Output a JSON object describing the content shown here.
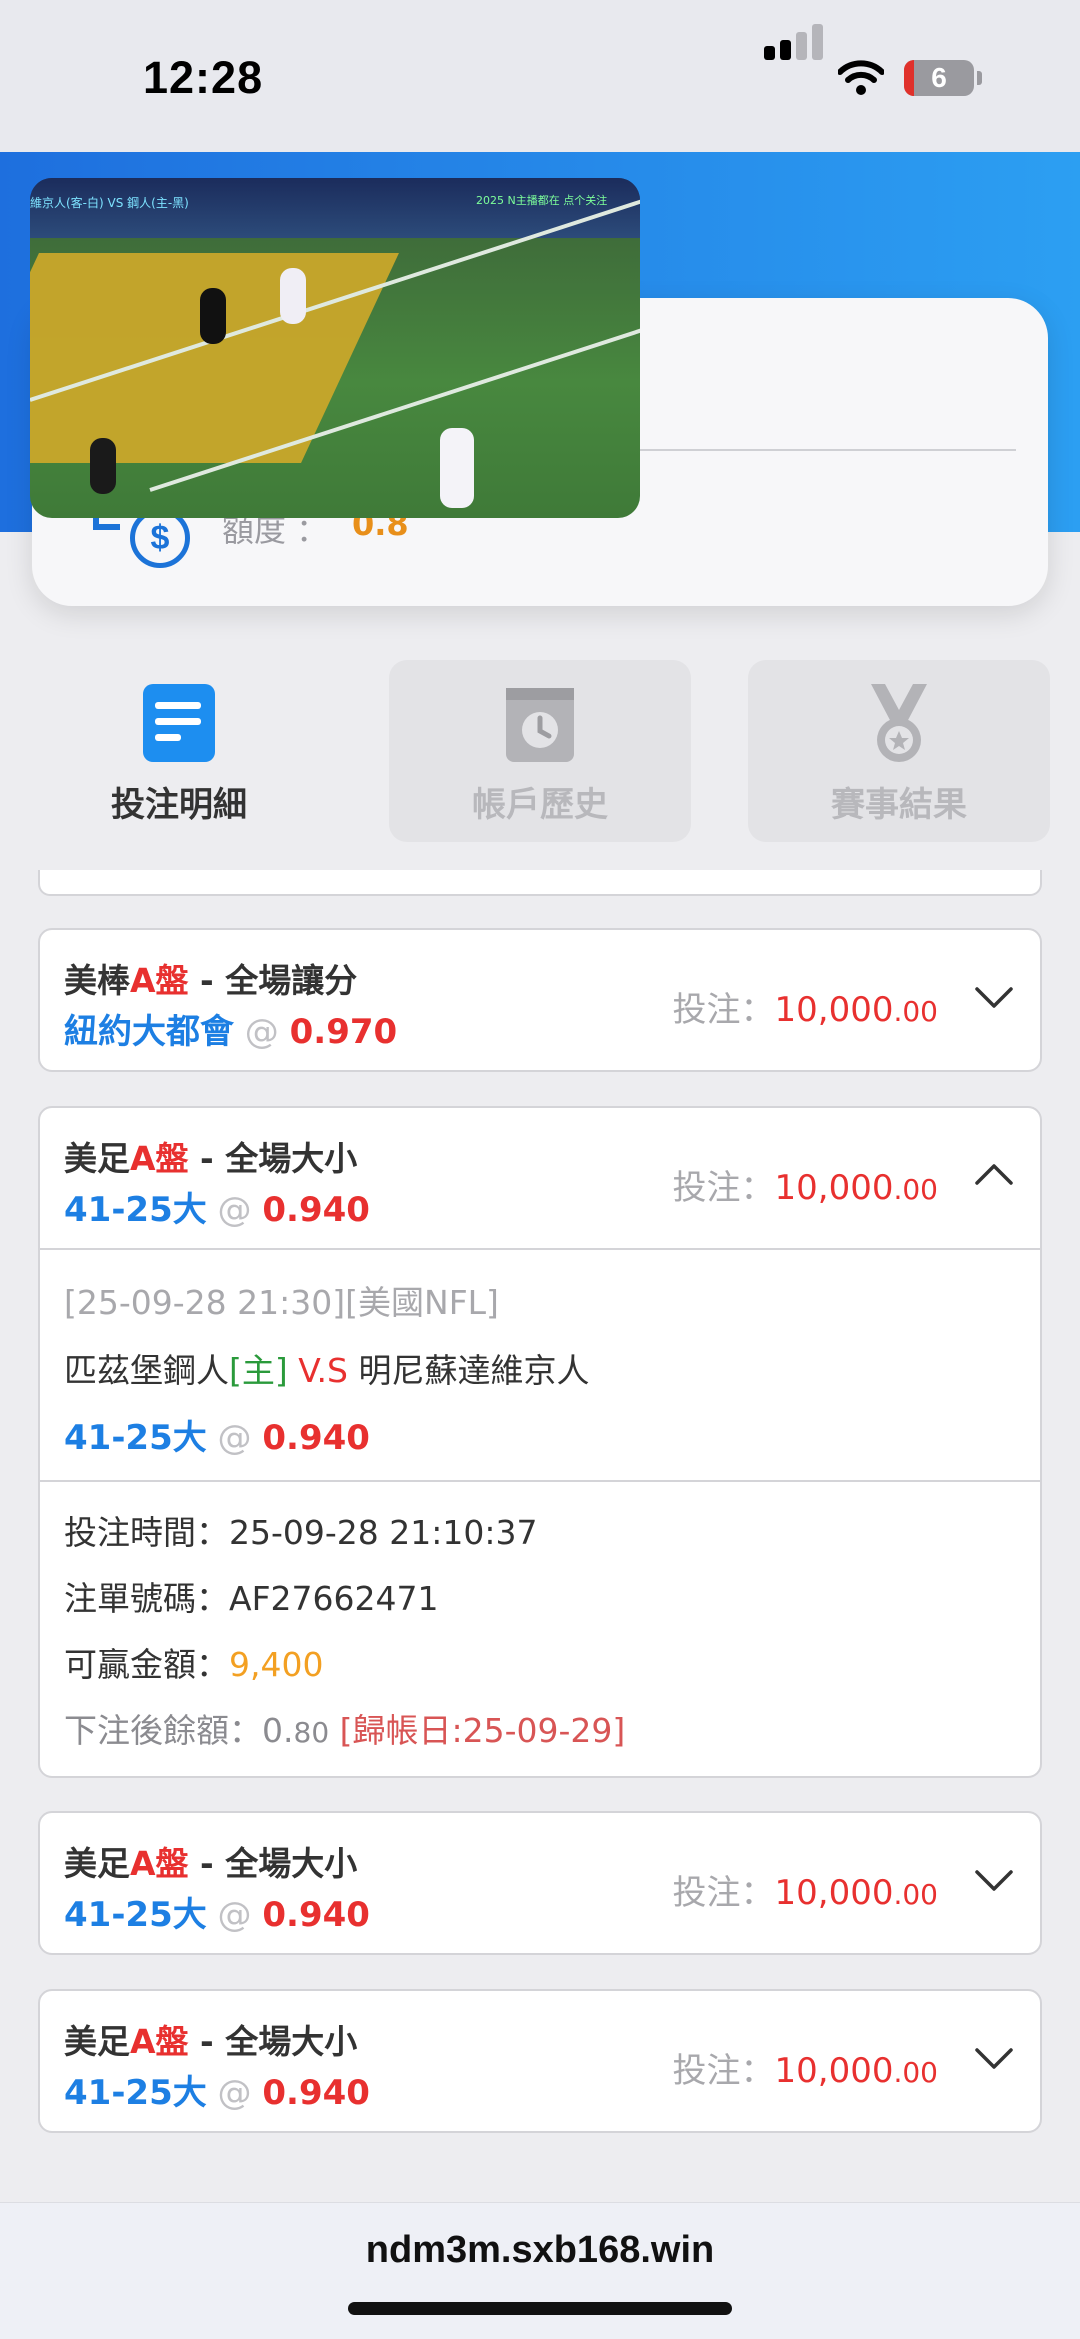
{
  "status_bar": {
    "time": "12:28",
    "battery": "6"
  },
  "account": {
    "partial_text": "4",
    "credit_label": "額度 ：",
    "credit_value": "0.8"
  },
  "tabs": [
    {
      "label": "投注明細",
      "icon": "receipt-icon",
      "active": true
    },
    {
      "label": "帳戶歷史",
      "icon": "clock-calendar-icon",
      "active": false
    },
    {
      "label": "賽事結果",
      "icon": "medal-icon",
      "active": false
    }
  ],
  "bets": [
    {
      "sport": "美棒",
      "market_code": "A盤",
      "market": " - 全場讓分",
      "pick": "紐約大都會",
      "at": " @ ",
      "odds": "0.970",
      "stake_label": "投注：",
      "stake_int": "10,000",
      "stake_dec": ".00",
      "expanded": false
    },
    {
      "sport": "美足",
      "market_code": "A盤",
      "market": " - 全場大小",
      "pick": "41-25大",
      "at": " @ ",
      "odds": "0.940",
      "stake_label": "投注：",
      "stake_int": "10,000",
      "stake_dec": ".00",
      "expanded": true,
      "detail": {
        "match_time": "[25-09-28 21:30][美國NFL]",
        "home_team": "匹茲堡鋼人",
        "home_tag": "[主]",
        "vs": " V.S ",
        "away_team": "明尼蘇達維京人",
        "pick": "41-25大",
        "odds": "0.940",
        "bet_time_label": "投注時間：",
        "bet_time": "25-09-28 21:10:37",
        "ticket_label": "注單號碼：",
        "ticket": "AF27662471",
        "win_label": "可贏金額：",
        "win": "9,400",
        "balance_label": "下注後餘額：",
        "balance_int": "0.",
        "balance_dec": "80",
        "settle": " [歸帳日:25-09-29]"
      }
    },
    {
      "sport": "美足",
      "market_code": "A盤",
      "market": " - 全場大小",
      "pick": "41-25大",
      "at": " @ ",
      "odds": "0.940",
      "stake_label": "投注：",
      "stake_int": "10,000",
      "stake_dec": ".00",
      "expanded": false
    },
    {
      "sport": "美足",
      "market_code": "A盤",
      "market": " - 全場大小",
      "pick": "41-25大",
      "at": " @ ",
      "odds": "0.940",
      "stake_label": "投注：",
      "stake_int": "10,000",
      "stake_dec": ".00",
      "expanded": false
    }
  ],
  "video": {
    "ticker_left": "維京人(客-白) VS 鋼人(主-黑)",
    "ticker_right": "2025 N主播都在 点个关注"
  },
  "browser": {
    "url": "ndm3m.sxb168.win"
  },
  "colors": {
    "accent_blue": "#1d7fe3",
    "odds_red": "#e8302f",
    "win_orange": "#f3a022"
  }
}
